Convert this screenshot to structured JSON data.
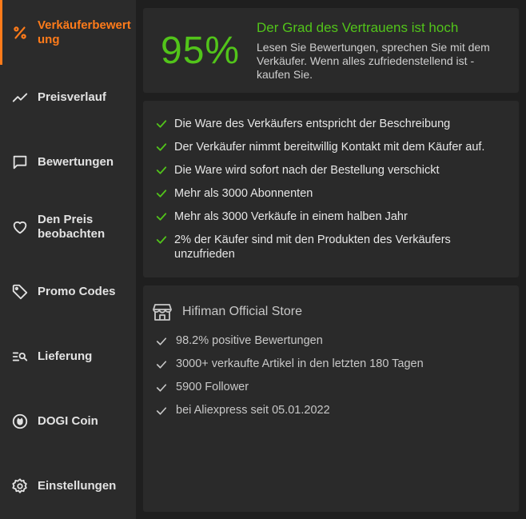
{
  "sidebar": {
    "items": [
      {
        "label": "Verkäuferbewertung",
        "icon": "percent-icon",
        "active": true
      },
      {
        "label": "Preisverlauf",
        "icon": "trend-icon"
      },
      {
        "label": "Bewertungen",
        "icon": "chat-icon"
      },
      {
        "label": "Den Preis beobachten",
        "icon": "heart-icon"
      },
      {
        "label": "Promo Codes",
        "icon": "tag-icon"
      },
      {
        "label": "Lieferung",
        "icon": "delivery-search-icon"
      },
      {
        "label": "DOGI Coin",
        "icon": "coin-icon"
      },
      {
        "label": "Einstellungen",
        "icon": "gear-icon"
      }
    ]
  },
  "score": {
    "value": "95%",
    "title": "Der Grad des Vertrauens ist hoch",
    "description": "Lesen Sie Bewertungen, sprechen Sie mit dem Verkäufer. Wenn alles zufriedenstellend ist - kaufen Sie."
  },
  "checks": [
    "Die Ware des Verkäufers entspricht der Beschreibung",
    "Der Verkäufer nimmt bereitwillig Kontakt mit dem Käufer auf.",
    "Die Ware wird sofort nach der Bestellung verschickt",
    "Mehr als 3000 Abonnenten",
    "Mehr als 3000 Verkäufe in einem halben Jahr",
    "2% der Käufer sind mit den Produkten des Verkäufers unzufrieden"
  ],
  "store": {
    "name": "Hifiman Official Store",
    "facts": [
      "98.2% positive Bewertungen",
      "3000+ verkaufte Artikel in den letzten 180 Tagen",
      "5900 Follower",
      "bei Aliexpress seit 05.01.2022"
    ]
  },
  "colors": {
    "accent": "#ff7b1a",
    "good": "#52c41a",
    "sidebar_bg": "#2b2b2b",
    "card_bg": "#2a2a2a",
    "page_bg": "#1f1f1f"
  }
}
